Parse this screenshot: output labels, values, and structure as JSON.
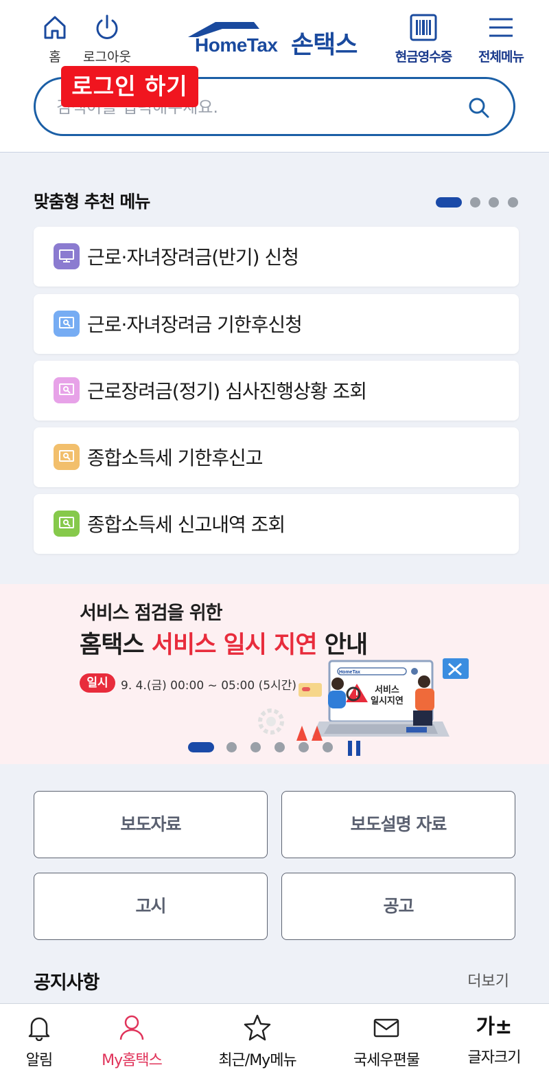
{
  "header": {
    "home_label": "홈",
    "logout_label": "로그아웃",
    "logo_en": "HomeTax",
    "logo_ko": "손택스",
    "receipt_label": "현금영수증",
    "menu_label": "전체메뉴",
    "login_badge": "로그인 하기"
  },
  "search": {
    "placeholder": "검색어를 입력해주세요."
  },
  "recommended": {
    "title": "맞춤형 추천 메뉴",
    "items": [
      {
        "label": "근로·자녀장려금(반기) 신청",
        "color": "#8b7bd0",
        "icon": "monitor-icon"
      },
      {
        "label": "근로·자녀장려금 기한후신청",
        "color": "#76acf3",
        "icon": "search-doc-icon"
      },
      {
        "label": "근로장려금(정기) 심사진행상황 조회",
        "color": "#e7a2e8",
        "icon": "search-doc-icon"
      },
      {
        "label": "종합소득세 기한후신고",
        "color": "#f2bf6c",
        "icon": "search-doc-icon"
      },
      {
        "label": "종합소득세 신고내역 조회",
        "color": "#86c94b",
        "icon": "search-doc-icon"
      }
    ]
  },
  "banner": {
    "line1": "서비스 점검을 위한",
    "line2_a": "홈택스 ",
    "line2_hl": "서비스 일시 지연",
    "line2_b": " 안내",
    "tag": "일시",
    "date": "9. 4.(금) 00:00 ~ 05:00 (5시간)",
    "illu_text1": "서비스",
    "illu_text2": "일시지연"
  },
  "buttons": {
    "press": "보도자료",
    "press_explain": "보도설명 자료",
    "notice_gov": "고시",
    "announcement": "공고"
  },
  "notice": {
    "title": "공지사항",
    "more": "더보기"
  },
  "bottom_nav": {
    "alarm": "알림",
    "my_hometax": "My홈택스",
    "recent": "최근/My메뉴",
    "mail": "국세우편물",
    "font_size": "글자크기",
    "font_icon_text": "가±"
  },
  "colors": {
    "brand": "#1a4a9e",
    "accent_red": "#e82c3c",
    "active_nav": "#e0335a"
  }
}
